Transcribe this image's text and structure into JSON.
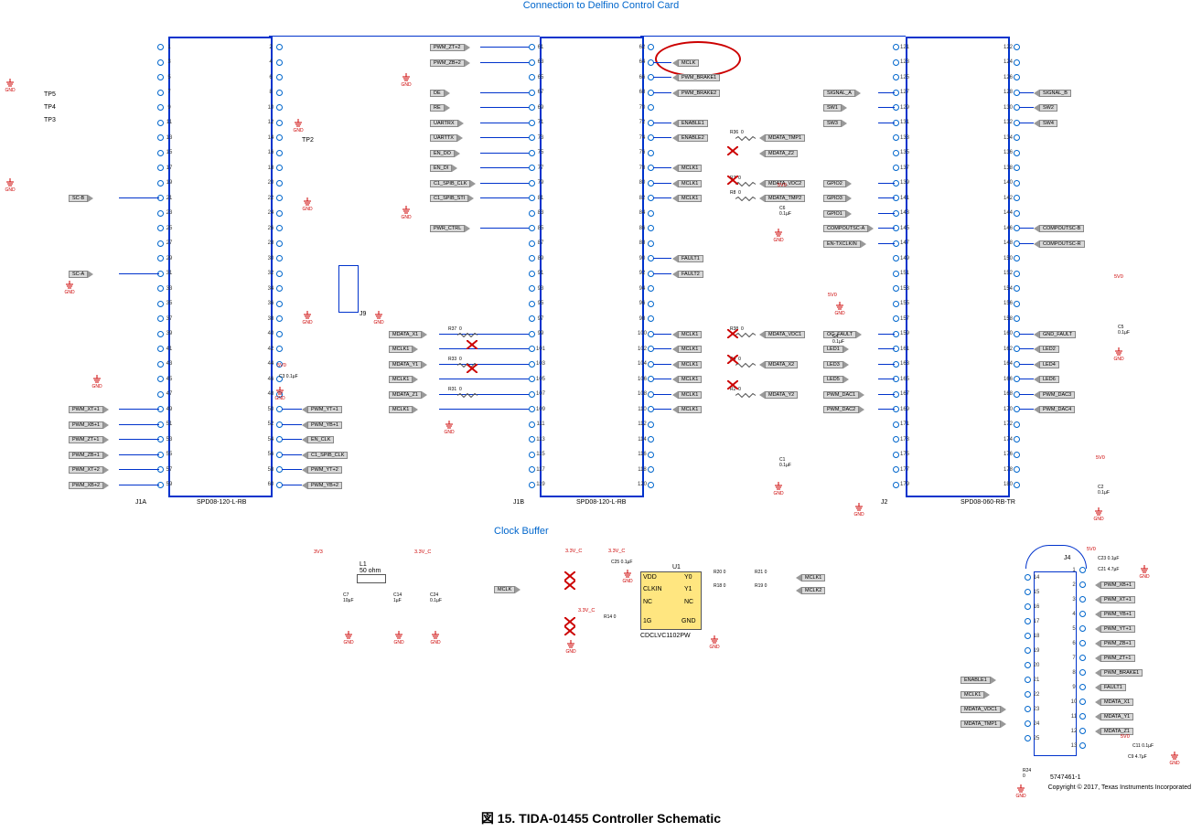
{
  "titles": {
    "top": "Connection to Delfino Control Card",
    "clock": "Clock Buffer",
    "figure": "図 15. TIDA-01455 Controller Schematic",
    "copyright": "Copyright © 2017, Texas Instruments Incorporated"
  },
  "connectors": {
    "J1A": {
      "ref": "J1A",
      "part": "SPD08-120-L-RB",
      "pins_left": [
        1,
        3,
        5,
        7,
        9,
        11,
        13,
        15,
        17,
        19,
        21,
        23,
        25,
        27,
        29,
        31,
        33,
        35,
        37,
        39,
        41,
        43,
        45,
        47,
        49,
        51,
        53,
        55,
        57,
        59
      ],
      "pins_right": [
        2,
        4,
        6,
        8,
        10,
        12,
        14,
        16,
        18,
        20,
        22,
        24,
        26,
        28,
        30,
        32,
        34,
        36,
        38,
        40,
        42,
        44,
        46,
        48,
        50,
        52,
        54,
        56,
        58,
        60
      ]
    },
    "J1B": {
      "ref": "J1B",
      "part": "SPD08-120-L-RB",
      "pins_left": [
        61,
        63,
        65,
        67,
        69,
        71,
        73,
        75,
        77,
        79,
        81,
        83,
        85,
        87,
        89,
        91,
        93,
        95,
        97,
        99,
        101,
        103,
        105,
        107,
        109,
        111,
        113,
        115,
        117,
        119
      ],
      "pins_right": [
        62,
        64,
        66,
        68,
        70,
        72,
        74,
        76,
        78,
        80,
        82,
        84,
        86,
        88,
        90,
        92,
        94,
        96,
        98,
        100,
        102,
        104,
        106,
        108,
        110,
        112,
        114,
        116,
        118,
        120
      ]
    },
    "J2": {
      "ref": "J2",
      "part": "SPD08-060-RB-TR",
      "pins_left": [
        121,
        123,
        125,
        127,
        129,
        131,
        133,
        135,
        137,
        139,
        141,
        143,
        145,
        147,
        149,
        151,
        153,
        155,
        157,
        159,
        161,
        163,
        165,
        167,
        169,
        171,
        173,
        175,
        177,
        179
      ],
      "pins_right": [
        122,
        124,
        126,
        128,
        130,
        132,
        134,
        136,
        138,
        140,
        142,
        144,
        146,
        148,
        150,
        152,
        154,
        156,
        158,
        160,
        162,
        164,
        166,
        168,
        170,
        172,
        174,
        176,
        178,
        180
      ]
    },
    "J4": {
      "ref": "J4",
      "part": "5747461-1",
      "pins_left": [
        14,
        15,
        16,
        17,
        18,
        19,
        20,
        21,
        22,
        23,
        24,
        25
      ],
      "pins_right": [
        1,
        2,
        3,
        4,
        5,
        6,
        7,
        8,
        9,
        10,
        11,
        12,
        13
      ]
    },
    "J9": {
      "ref": "J9"
    }
  },
  "nets_left_J1A": {
    "21": "SC-B",
    "31": "SC-A",
    "49": "PWM_XT+1",
    "51": "PWM_XB+1",
    "53": "PWM_ZT+1",
    "55": "PWM_ZB+1",
    "57": "PWM_XT+2",
    "59": "PWM_XB+2"
  },
  "nets_right_J1A": {
    "50": "PWM_YT+1",
    "52": "PWM_YB+1",
    "54": "EN_CLK",
    "56": "C1_SPIB_CLK",
    "58": "PWM_YT+2",
    "60": "PWM_YB+2"
  },
  "nets_left_J1B": {
    "61": "PWM_ZT+2",
    "63": "PWM_ZB+2",
    "67": "DE",
    "69": "RE",
    "71": "UARTRX",
    "73": "UARTTX",
    "75": "EN_DO",
    "77": "EN_DI",
    "79": "C1_SPIB_CLK",
    "81": "C1_SPIB_STI",
    "85": "PWR_CTRL",
    "99": "MDATA_X1",
    "101": "MCLK1",
    "103": "MDATA_Y1",
    "105": "MCLK1",
    "107": "MDATA_Z1",
    "109": "MCLK1"
  },
  "nets_right_J1B": {
    "64": "MCLK",
    "66": "PWM_BRAKE1",
    "68": "PWM_BRAKE2",
    "72": "ENABLE1",
    "74": "ENABLE2",
    "78": "MCLK1",
    "80": "MCLK1",
    "82": "MCLK1",
    "90": "FAULT1",
    "92": "FAULT2",
    "100": "MCLK1",
    "102": "MCLK1",
    "104": "MCLK1",
    "106": "MCLK1",
    "108": "MCLK1",
    "110": "MCLK1"
  },
  "nets_left_J2": {
    "127": "SIGNAL_A",
    "129": "SW1",
    "131": "SW3",
    "139": "GPIO2",
    "141": "GPIO3",
    "143": "GPIO1",
    "145": "COMPOUTSC-A",
    "147": "EN-TXCLKIN",
    "159": "OC_FAULT",
    "161": "LED1",
    "163": "LED3",
    "165": "LED5",
    "167": "PWM_DAC1",
    "169": "PWM_DAC2"
  },
  "nets_right_J2": {
    "128": "SIGNAL_B",
    "130": "SW2",
    "132": "SW4",
    "146": "COMPOUTSC-B",
    "148": "COMPOUTSC-R",
    "160": "GND_FAULT",
    "162": "LED2",
    "164": "LED4",
    "166": "LED6",
    "168": "PWM_DAC3",
    "170": "PWM_DAC4"
  },
  "resistors": {
    "R37": "0",
    "R33": "0",
    "R31": "0",
    "R36": "0",
    "R7": "0",
    "R8": "0",
    "R38": "0",
    "R4": "0",
    "R2": "0",
    "R14": "0",
    "R20": "0",
    "R21": "0",
    "R18": "0",
    "R19": "0",
    "R24": "0",
    "R35": "0",
    "R34": "0"
  },
  "capacitors": {
    "C3": "0.1µF",
    "C6": "0.1µF",
    "C1": "0.1µF",
    "C4": "0.1µF",
    "C5": "0.1µF",
    "C2": "0.1µF",
    "C7": "10µF",
    "C14": "1µF",
    "C24": "0.1µF",
    "C25": "0.1µF",
    "C23": "0.1µF",
    "C21": "4.7µF",
    "C11": "0.1µF",
    "C9": "4.7µF"
  },
  "ic": {
    "U1": "CDCLVC1102PW",
    "pins": {
      "1": "VDD",
      "2": "CLKIN",
      "3": "NC",
      "4": "GND",
      "5": "NC",
      "6": "1G",
      "7": "Y1",
      "8": "Y0"
    }
  },
  "clock_nets": {
    "in": "MCLK",
    "out1": "MCLK1",
    "out2": "MCLK2"
  },
  "inductor": {
    "L1": "50 ohm"
  },
  "power": {
    "3v3": "3V3",
    "3v3c": "3.3V_C",
    "5v0": "5V0"
  },
  "tp": {
    "TP5": "TP5",
    "TP4": "TP4",
    "TP3": "TP3",
    "TP2": "TP2"
  },
  "mdata_extra": {
    "74": "MDATA_TMP1",
    "76": "MDATA_Z2",
    "80": "MDATA_VDC2",
    "82": "MDATA_TMP2",
    "100": "MDATA_VDC1",
    "104": "MDATA_X2",
    "108": "MDATA_Y2"
  },
  "j4_nets_right": [
    "",
    "PWM_XB+1",
    "PWM_XT+1",
    "PWM_YB+1",
    "PWM_YT+1",
    "PWM_ZB+1",
    "PWM_ZT+1",
    "PWM_BRAKE1",
    "FAULT1",
    "MDATA_X1",
    "MDATA_Y1",
    "MDATA_Z1",
    ""
  ],
  "j4_nets_left": [
    "",
    "",
    "",
    "",
    "",
    "",
    "",
    "ENABLE1",
    "MCLK1",
    "MDATA_VDC1",
    "MDATA_TMP1",
    ""
  ]
}
